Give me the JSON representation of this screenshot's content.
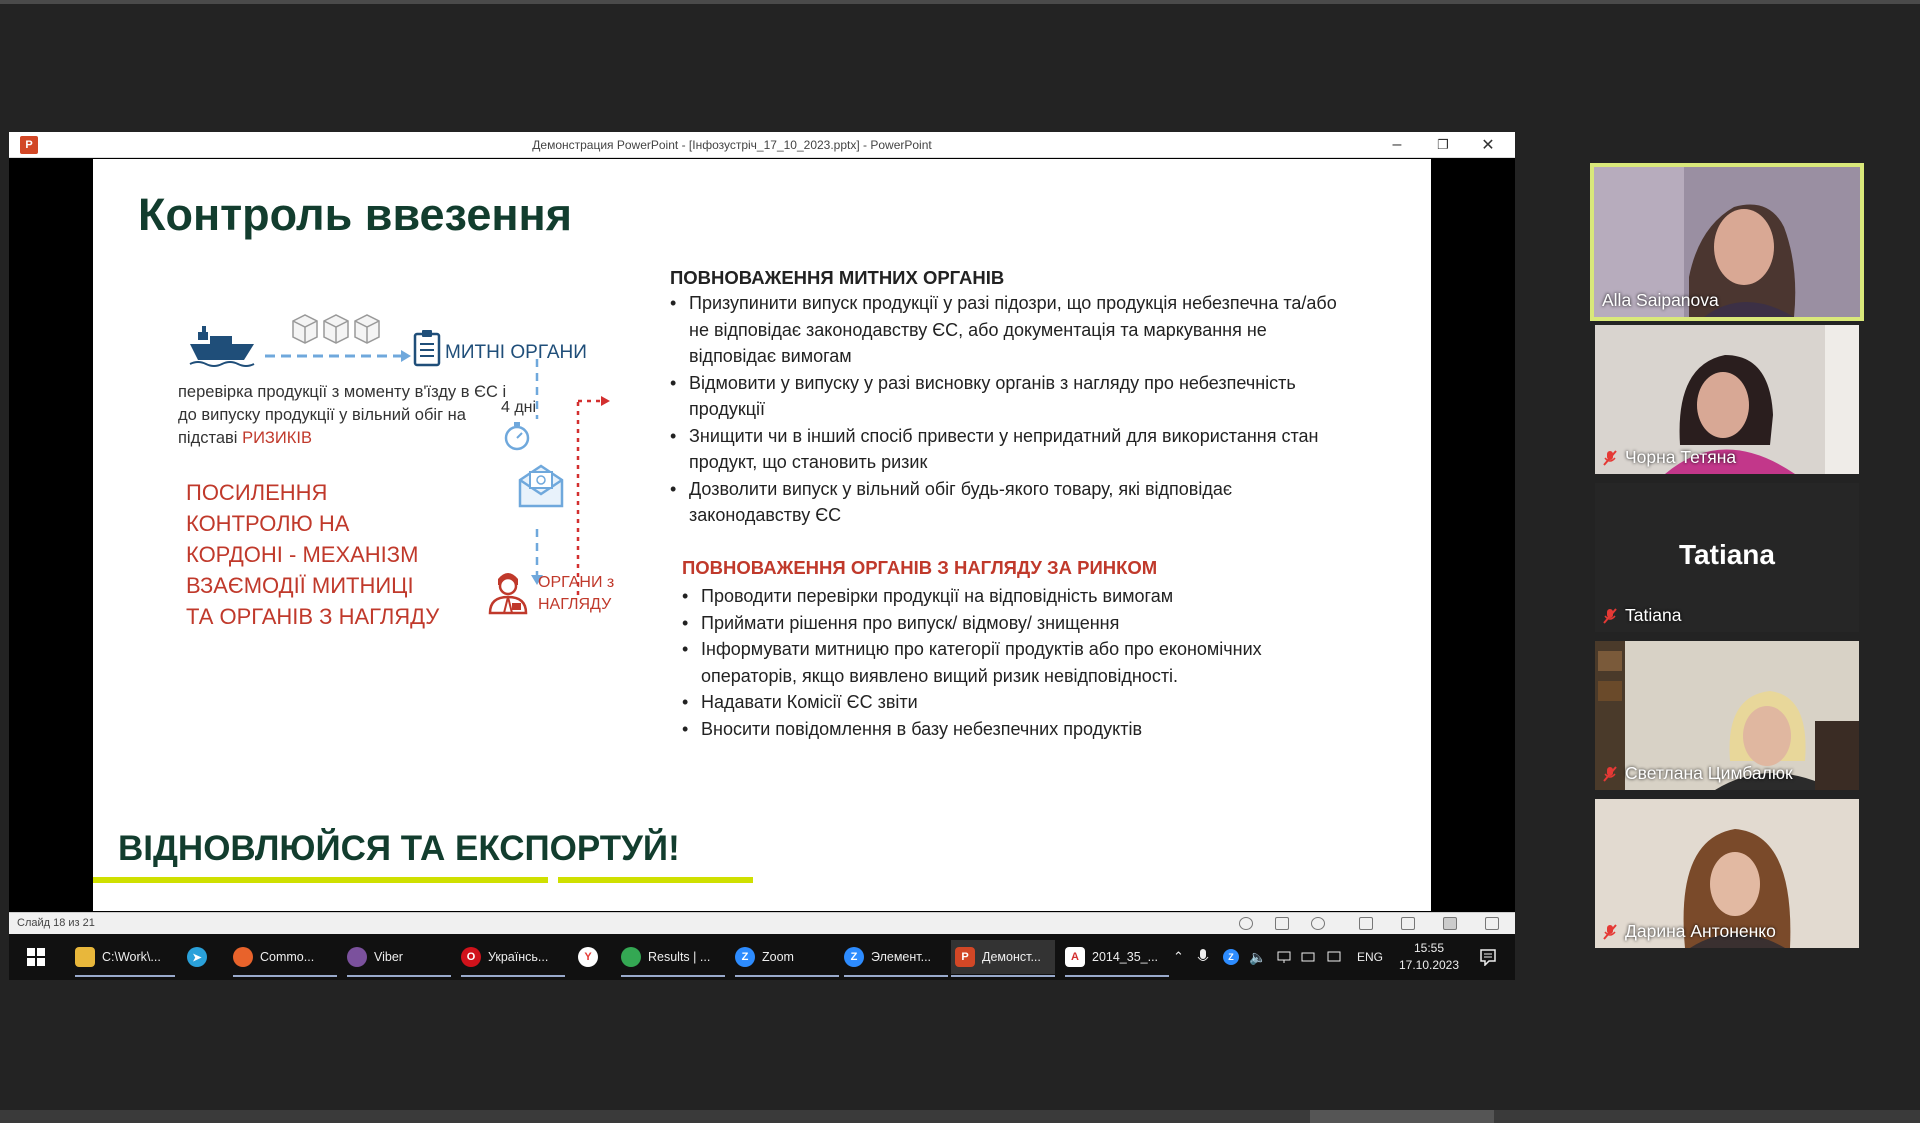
{
  "window": {
    "title": "Демонстрация PowerPoint - [Інфозустріч_17_10_2023.pptx] - PowerPoint",
    "minimize": "–",
    "restore": "❐",
    "close": "✕"
  },
  "slide": {
    "title": "Контроль ввезення",
    "diagram": {
      "customs_label": "МИТНІ ОРГАНИ",
      "check_text": "перевірка продукції з моменту в'їзду в ЄС і до випуску продукції у вільний обіг на підставі",
      "risk_word": "РИЗИКІВ",
      "days": "4 дні",
      "organs_label_line1": "ОРГАНИ з",
      "organs_label_line2": "НАГЛЯДУ",
      "strength_text": "ПОСИЛЕННЯ КОНТРОЛЮ НА КОРДОНІ - МЕХАНІЗМ ВЗАЄМОДІЇ МИТНИЦІ ТА ОРГАНІВ З НАГЛЯДУ"
    },
    "customs_section": {
      "title": "ПОВНОВАЖЕННЯ МИТНИХ ОРГАНІВ",
      "bullets": [
        "Призупинити випуск продукції у разі підозри, що продукція небезпечна та/або не відповідає законодавству ЄС, або документація та маркування не відповідає вимогам",
        "Відмовити у випуску у разі висновку органів з нагляду про небезпечність продукції",
        "Знищити чи в інший спосіб привести у непридатний для використання стан продукт, що становить ризик",
        "Дозволити випуск у вільний обіг будь-якого товару, які відповідає законодавству ЄС"
      ]
    },
    "market_section": {
      "title": "ПОВНОВАЖЕННЯ ОРГАНІВ З НАГЛЯДУ ЗА РИНКОМ",
      "bullets": [
        "Проводити перевірки продукції на відповідність вимогам",
        "Приймати рішення про випуск/ відмову/ знищення",
        "Інформувати митницю про категорії продуктів або про економічних операторів, якщо виявлено вищий ризик невідповідності.",
        "Надавати Комісії ЄС звіти",
        "Вносити повідомлення в базу небезпечних продуктів"
      ]
    },
    "slogan": "ВІДНОВЛЮЙСЯ ТА ЕКСПОРТУЙ!"
  },
  "statusbar": {
    "slide_counter": "Слайд 18 из 21"
  },
  "taskbar": {
    "items": [
      {
        "label": "C:\\Work\\...",
        "icon": "folder-icon",
        "color": "#e8b73b"
      },
      {
        "label": "",
        "icon": "telegram-icon",
        "color": "#2aa1da"
      },
      {
        "label": "Commo...",
        "icon": "firefox-icon",
        "color": "#e8632b"
      },
      {
        "label": "Viber",
        "icon": "viber-icon",
        "color": "#7b519d"
      },
      {
        "label": "Українсь...",
        "icon": "opera-icon",
        "color": "#d0121b"
      },
      {
        "label": "",
        "icon": "yandex-icon",
        "color": "#e53935"
      },
      {
        "label": "Results | ...",
        "icon": "chrome-icon",
        "color": "#34a853"
      },
      {
        "label": "Zoom",
        "icon": "zoom-icon",
        "color": "#2d8cff"
      },
      {
        "label": "Элемент...",
        "icon": "zoom-icon",
        "color": "#2d8cff"
      },
      {
        "label": "Демонст...",
        "icon": "powerpoint-icon",
        "color": "#d24726"
      },
      {
        "label": "2014_35_...",
        "icon": "pdf-icon",
        "color": "#d32f2f"
      }
    ],
    "tray": {
      "lang": "ENG",
      "time": "15:55",
      "date": "17.10.2023"
    }
  },
  "participants": [
    {
      "name": "Alla Saipanova",
      "muted": false,
      "bg": "#8a7e93"
    },
    {
      "name": "Чорна Тетяна",
      "muted": true,
      "bg": "#a27f83"
    },
    {
      "name": "Tatiana",
      "muted": true,
      "bg": "#262626",
      "avatar_text": "Tatiana"
    },
    {
      "name": "Светлана Цимбалюк",
      "muted": true,
      "bg": "#9a8f80"
    },
    {
      "name": "Дарина Антоненко",
      "muted": true,
      "bg": "#b5a796"
    }
  ],
  "colors": {
    "title_green": "#123d2e",
    "accent_red": "#c0392b",
    "lime": "#cfe000",
    "speaker_border": "#d9e87a"
  }
}
